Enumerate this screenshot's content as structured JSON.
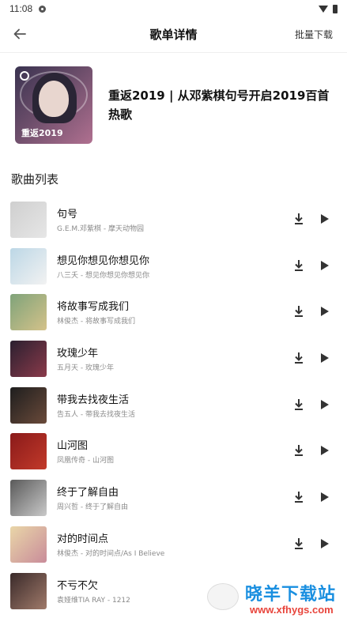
{
  "status_bar": {
    "time": "11:08"
  },
  "header": {
    "title": "歌单详情",
    "batch_download": "批量下载"
  },
  "playlist": {
    "cover_label": "重返2019",
    "title": "重返2019 | 从邓紫棋句号开启2019百首热歌"
  },
  "section_label": "歌曲列表",
  "songs": [
    {
      "name": "句号",
      "sub": "G.E.M.邓紫棋 - 摩天动物园",
      "thumb": [
        "#cfcfcf",
        "#e6e6e6"
      ]
    },
    {
      "name": "想见你想见你想见你",
      "sub": "八三夭 - 想见你想见你想见你",
      "thumb": [
        "#bcd7e6",
        "#f2f2f2"
      ]
    },
    {
      "name": "将故事写成我们",
      "sub": "林俊杰 - 将故事写成我们",
      "thumb": [
        "#7fa37a",
        "#d4c28a"
      ]
    },
    {
      "name": "玫瑰少年",
      "sub": "五月天 - 玫瑰少年",
      "thumb": [
        "#2b2030",
        "#8a3a4a"
      ]
    },
    {
      "name": "带我去找夜生活",
      "sub": "告五人 - 带我去找夜生活",
      "thumb": [
        "#1e1e1e",
        "#6a4a3a"
      ]
    },
    {
      "name": "山河图",
      "sub": "凤凰传奇 - 山河图",
      "thumb": [
        "#8a1a1a",
        "#c23a2a"
      ]
    },
    {
      "name": "终于了解自由",
      "sub": "周兴哲 - 终于了解自由",
      "thumb": [
        "#5a5a5a",
        "#c9c9c9"
      ]
    },
    {
      "name": "对的时间点",
      "sub": "林俊杰 - 对的时间点/As I Believe",
      "thumb": [
        "#e9d6a8",
        "#c98c9a"
      ]
    },
    {
      "name": "不亏不欠",
      "sub": "袁娅维TIA RAY - 1212",
      "thumb": [
        "#3a2a2a",
        "#a07a6a"
      ]
    }
  ],
  "watermark": {
    "text": "晓羊下载站",
    "url": "www.xfhygs.com"
  },
  "colors": {
    "accent_blue": "#1a8fe0",
    "accent_red": "#e8453c"
  }
}
